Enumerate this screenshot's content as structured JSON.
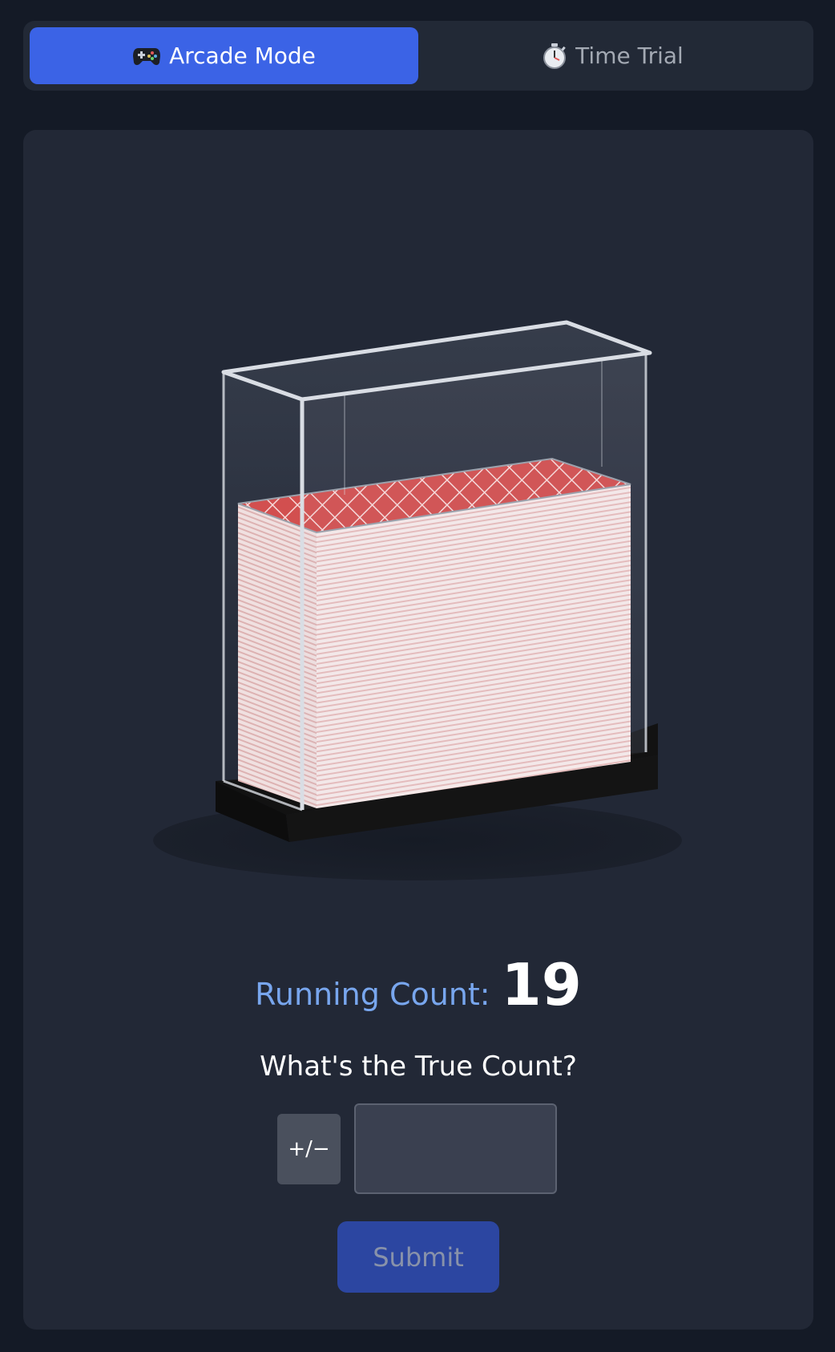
{
  "mode_tabs": [
    {
      "label": "Arcade Mode",
      "icon": "gamepad-icon",
      "active": true
    },
    {
      "label": "Time Trial",
      "icon": "stopwatch-icon",
      "active": false
    }
  ],
  "shoe": {
    "card_back_color": "#d24f4f",
    "card_edge_color": "#f4e4e4",
    "base_color": "#111111"
  },
  "count": {
    "running_label": "Running Count:",
    "running_value": "19",
    "prompt": "What's the True Count?",
    "sign_toggle_label": "+/−",
    "input_value": "",
    "submit_label": "Submit"
  },
  "colors": {
    "accent": "#3b63e6",
    "panel": "#222836",
    "background": "#141a26"
  }
}
